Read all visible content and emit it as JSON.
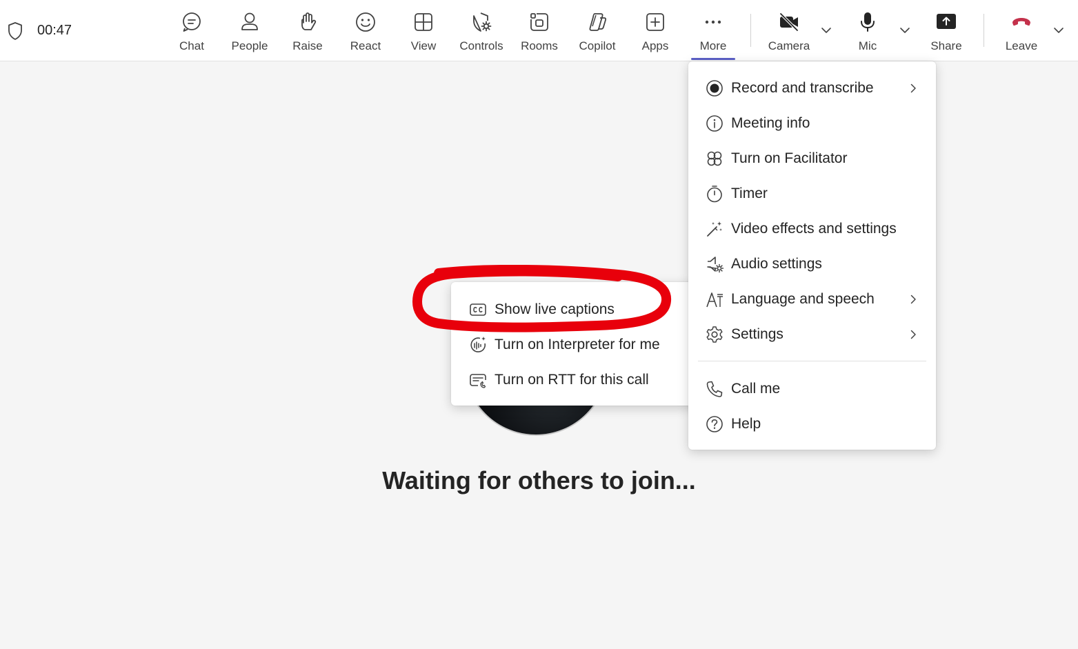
{
  "call": {
    "elapsed": "00:47"
  },
  "toolbar": {
    "chat": "Chat",
    "people": "People",
    "raise": "Raise",
    "react": "React",
    "view": "View",
    "controls": "Controls",
    "rooms": "Rooms",
    "copilot": "Copilot",
    "apps": "Apps",
    "more": "More",
    "camera": "Camera",
    "mic": "Mic",
    "share": "Share",
    "leave": "Leave"
  },
  "more_menu": {
    "items": [
      {
        "label": "Record and transcribe",
        "icon": "record-icon",
        "has_submenu": true
      },
      {
        "label": "Meeting info",
        "icon": "info-icon",
        "has_submenu": false
      },
      {
        "label": "Turn on Facilitator",
        "icon": "facilitator-icon",
        "has_submenu": false
      },
      {
        "label": "Timer",
        "icon": "timer-icon",
        "has_submenu": false
      },
      {
        "label": "Video effects and settings",
        "icon": "magic-wand-icon",
        "has_submenu": false
      },
      {
        "label": "Audio settings",
        "icon": "speaker-settings-icon",
        "has_submenu": false
      },
      {
        "label": "Language and speech",
        "icon": "language-icon",
        "has_submenu": true
      },
      {
        "label": "Settings",
        "icon": "gear-icon",
        "has_submenu": true
      },
      {
        "label": "Call me",
        "icon": "phone-icon",
        "has_submenu": false
      },
      {
        "label": "Help",
        "icon": "help-icon",
        "has_submenu": false
      }
    ]
  },
  "language_submenu": {
    "items": [
      {
        "label": "Show live captions",
        "icon": "closed-captions-icon"
      },
      {
        "label": "Turn on Interpreter for me",
        "icon": "interpreter-icon"
      },
      {
        "label": "Turn on RTT for this call",
        "icon": "rtt-icon"
      }
    ]
  },
  "stage": {
    "status": "Waiting for others to join..."
  },
  "colors": {
    "accent": "#5b5fc7",
    "leave_red": "#c4314b",
    "annotation_red": "#e8000b",
    "background": "#f5f5f5"
  }
}
